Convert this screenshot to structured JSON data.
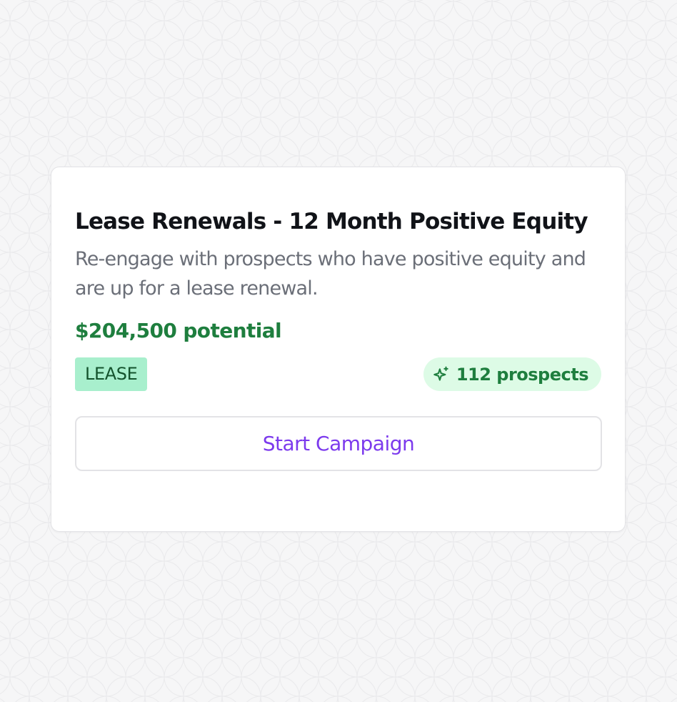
{
  "card": {
    "title": "Lease Renewals - 12 Month Positive Equity",
    "description": "Re-engage with prospects who have positive equity and are up for a lease renewal.",
    "potential": "$204,500 potential",
    "tag": "LEASE",
    "prospects": "112 prospects",
    "prospects_icon": "sparkle-icon",
    "button_label": "Start Campaign"
  },
  "colors": {
    "accent": "#7c3aed",
    "positive": "#1e7e3e",
    "tag_bg": "#a8efcd",
    "pill_bg": "#ddfbe6"
  }
}
